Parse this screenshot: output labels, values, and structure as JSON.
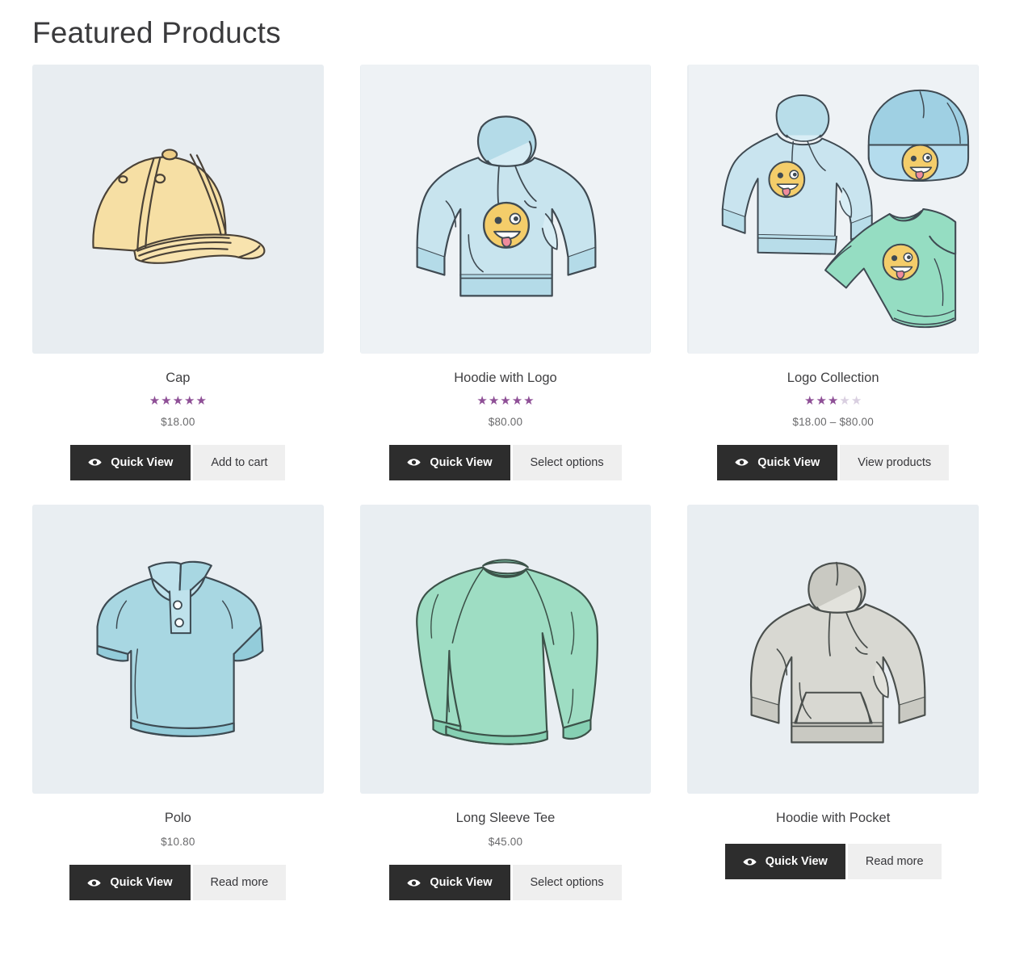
{
  "header": {
    "title": "Featured Products"
  },
  "colors": {
    "thumb_background": "#e8edf1",
    "star_filled": "#8e4f96",
    "star_empty": "#d9cfe0",
    "quickview_background": "#2d2d2d",
    "secondary_background": "#efefef",
    "title_text": "#3a3a3c",
    "price_text": "#6a6a6c"
  },
  "buttons": {
    "quick_view_label": "Quick View",
    "eye_icon_name": "eye-icon"
  },
  "products": [
    {
      "name": "Cap",
      "price": "$18.00",
      "rating_filled": 5,
      "rating_total": 5,
      "has_rating": true,
      "has_price": true,
      "action_label": "Add to cart",
      "image_name": "cap-illustration"
    },
    {
      "name": "Hoodie with Logo",
      "price": "$80.00",
      "rating_filled": 5,
      "rating_total": 5,
      "has_rating": true,
      "has_price": true,
      "action_label": "Select options",
      "image_name": "hoodie-with-logo-illustration"
    },
    {
      "name": "Logo Collection",
      "price": "$18.00 – $80.00",
      "rating_filled": 3,
      "rating_total": 5,
      "has_rating": true,
      "has_price": true,
      "action_label": "View products",
      "image_name": "logo-collection-illustration"
    },
    {
      "name": "Polo",
      "price": "$10.80",
      "rating_filled": 0,
      "rating_total": 5,
      "has_rating": false,
      "has_price": true,
      "action_label": "Read more",
      "image_name": "polo-illustration"
    },
    {
      "name": "Long Sleeve Tee",
      "price": "$45.00",
      "rating_filled": 0,
      "rating_total": 5,
      "has_rating": false,
      "has_price": true,
      "action_label": "Select options",
      "image_name": "long-sleeve-tee-illustration"
    },
    {
      "name": "Hoodie with Pocket",
      "price": "",
      "rating_filled": 0,
      "rating_total": 5,
      "has_rating": false,
      "has_price": false,
      "action_label": "Read more",
      "image_name": "hoodie-with-pocket-illustration"
    }
  ]
}
